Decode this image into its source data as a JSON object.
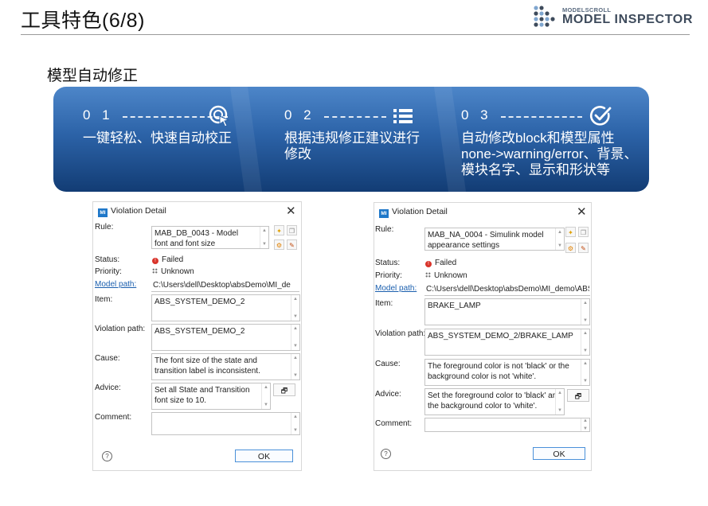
{
  "slide": {
    "title": "工具特色(6/8)",
    "section_title": "模型自动修正"
  },
  "logo": {
    "small": "MODELSCROLL",
    "big": "MODEL INSPECTOR",
    "accent_color": "#3e4b5c"
  },
  "banner": {
    "features": [
      {
        "num": "0 1",
        "icon": "cursor-click-icon",
        "lines": [
          "一键轻松、快速自动校正"
        ]
      },
      {
        "num": "0 2",
        "icon": "list-icon",
        "lines": [
          "根据违规修正建议进行",
          "修改"
        ]
      },
      {
        "num": "0 3",
        "icon": "check-circle-icon",
        "lines": [
          "自动修改block和模型属性",
          "none->warning/error、背景、",
          "模块名字、显示和形状等"
        ]
      }
    ]
  },
  "dialogs": [
    {
      "title": "Violation Detail",
      "badge": "MI",
      "labels": {
        "rule": "Rule:",
        "status": "Status:",
        "priority": "Priority:",
        "model_path": "Model path:",
        "item": "Item:",
        "violation_path": "Violation path:",
        "cause": "Cause:",
        "advice": "Advice:",
        "comment": "Comment:"
      },
      "rule": [
        "MAB_DB_0043 - Model",
        "font and font size"
      ],
      "status": "Failed",
      "priority": "Unknown",
      "model_path": "C:\\Users\\dell\\Desktop\\absDemo\\MI_de",
      "item": "ABS_SYSTEM_DEMO_2",
      "violation_path": "ABS_SYSTEM_DEMO_2",
      "cause": [
        "The font size of the state and",
        "transition label is inconsistent."
      ],
      "advice": [
        "Set all State and Transition",
        "font size to 10."
      ],
      "comment": "",
      "ok": "OK"
    },
    {
      "title": "Violation Detail",
      "badge": "MI",
      "labels": {
        "rule": "Rule:",
        "status": "Status:",
        "priority": "Priority:",
        "model_path": "Model path:",
        "item": "Item:",
        "violation_path": "Violation path:",
        "cause": "Cause:",
        "advice": "Advice:",
        "comment": "Comment:"
      },
      "rule": [
        "MAB_NA_0004 - Simulink model",
        "appearance settings"
      ],
      "status": "Failed",
      "priority": "Unknown",
      "model_path": "C:\\Users\\dell\\Desktop\\absDemo\\MI_demo\\ABS_S",
      "item": "BRAKE_LAMP",
      "violation_path": "ABS_SYSTEM_DEMO_2/BRAKE_LAMP",
      "cause": [
        "The foreground color is not 'black' or the",
        "background color is not 'white'."
      ],
      "advice": [
        "Set the foreground color to 'black' and",
        "the background color to 'white'."
      ],
      "comment": "",
      "ok": "OK"
    }
  ]
}
